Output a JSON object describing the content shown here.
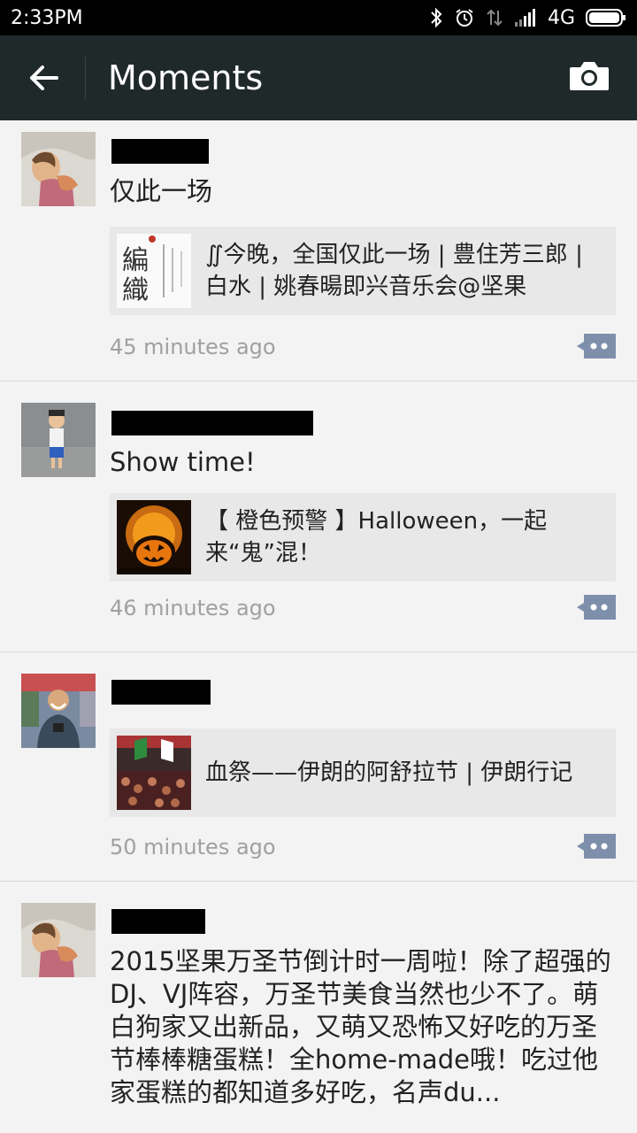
{
  "status_bar": {
    "time": "2:33PM",
    "network": "4G"
  },
  "header": {
    "title": "Moments",
    "back_icon": "arrow-left-icon",
    "camera_icon": "camera-icon"
  },
  "colors": {
    "header_bg": "#20292a",
    "card_bg": "#e8e8e8",
    "comment_btn": "#7e8fab"
  },
  "posts": [
    {
      "text": "仅此一场",
      "share_title": "∬今晚，全国仅此一场 | 豊住芳三郎 | 白水 | 姚春暘即兴音乐会@坚果",
      "time": "45 minutes ago"
    },
    {
      "text": "Show time!",
      "share_title": "【 橙色预警 】Halloween，一起来“鬼”混！",
      "time": "46 minutes ago"
    },
    {
      "text": "",
      "share_title": "血祭——伊朗的阿舒拉节 | 伊朗行记",
      "time": "50 minutes ago"
    },
    {
      "text": "2015坚果万圣节倒计时一周啦！除了超强的DJ、VJ阵容，万圣节美食当然也少不了。萌白狗家又出新品，又萌又恐怖又好吃的万圣节棒棒糖蛋糕！全home-made哦！吃过他家蛋糕的都知道多好吃，名声du..."
    }
  ]
}
